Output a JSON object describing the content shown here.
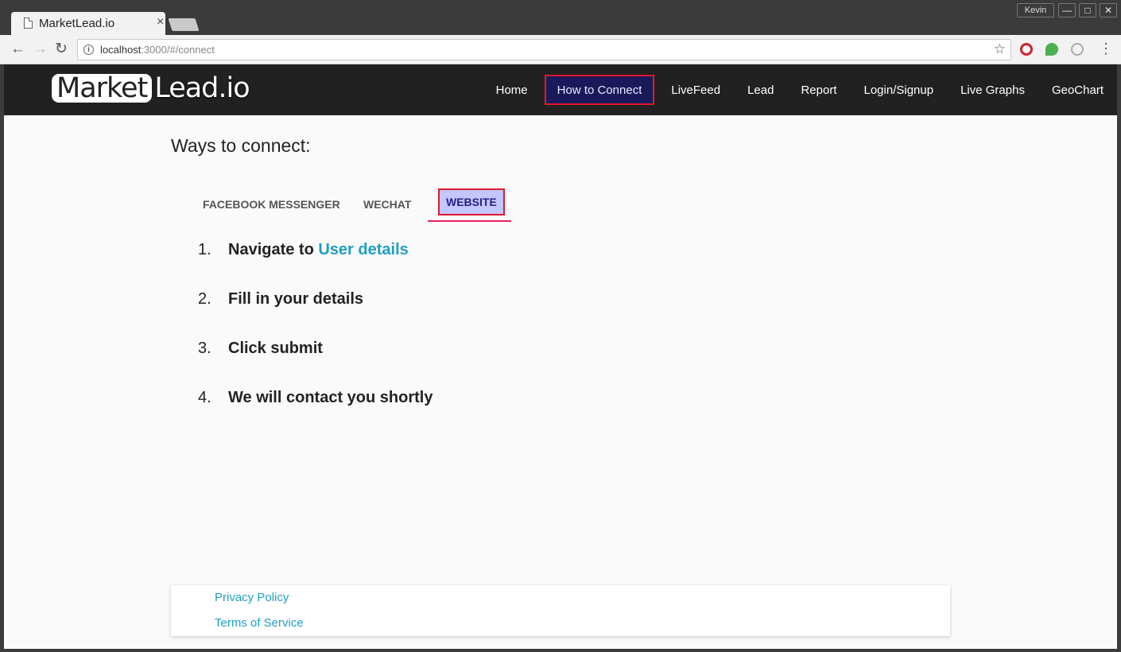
{
  "browser": {
    "tab_title": "MarketLead.io",
    "tab_close": "×",
    "user": "Kevin",
    "window_buttons": [
      "—",
      "□",
      "✕"
    ],
    "url_host": "localhost",
    "url_path": ":3000/#/connect",
    "nav": {
      "back": "←",
      "forward": "→",
      "reload": "↻",
      "info": "i",
      "bookmark": "☆",
      "menu": "⋮"
    }
  },
  "site": {
    "logo_box": "Market",
    "logo_rest": "Lead.io",
    "nav": [
      "Home",
      "How to Connect",
      "LiveFeed",
      "Lead",
      "Report",
      "Login/Signup",
      "Live Graphs",
      "GeoChart"
    ],
    "active_nav": "How to Connect"
  },
  "main": {
    "heading": "Ways to connect:",
    "tabs": [
      "FACEBOOK MESSENGER",
      "WECHAT",
      "WEBSITE"
    ],
    "active_tab": "WEBSITE",
    "steps": [
      {
        "num": "1.",
        "text": "Navigate to ",
        "link": "User details"
      },
      {
        "num": "2.",
        "text": "Fill in your details"
      },
      {
        "num": "3.",
        "text": "Click submit"
      },
      {
        "num": "4.",
        "text": "We will contact you shortly"
      }
    ]
  },
  "footer": {
    "privacy": "Privacy Policy",
    "terms": "Terms of Service"
  },
  "colors": {
    "navbar": "#212121",
    "highlight_border": "#e0192e",
    "link": "#1e9fc4",
    "tab_indicator": "#e91e63"
  }
}
